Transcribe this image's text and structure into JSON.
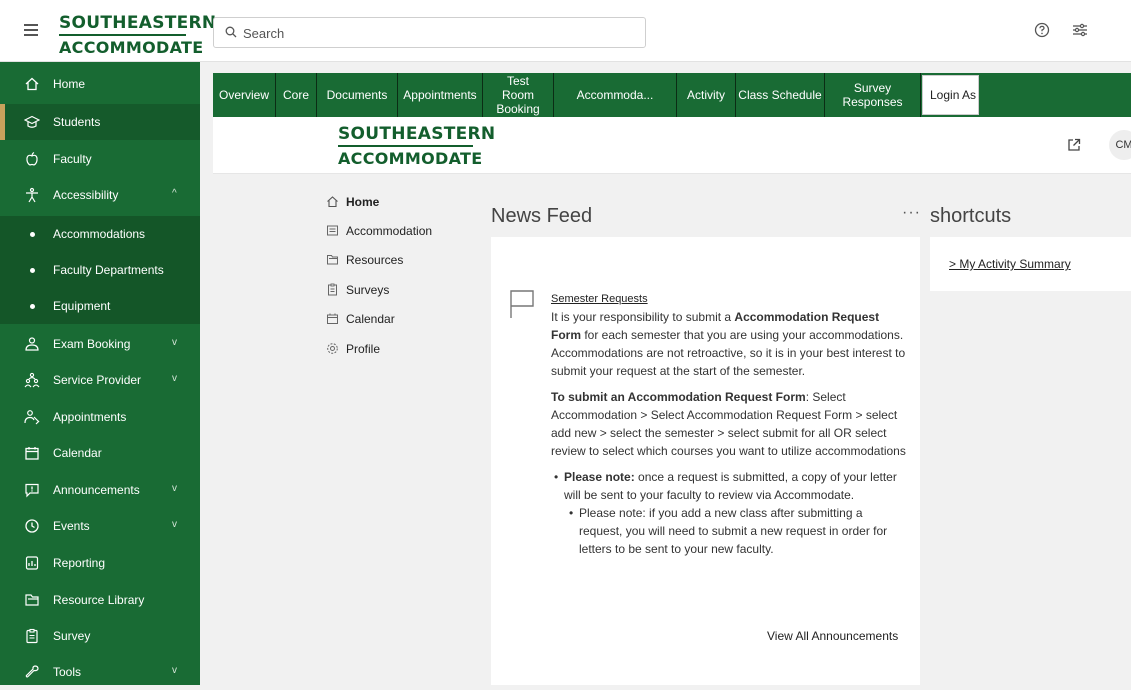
{
  "brand": {
    "line1": "SOUTHEASTERN",
    "line2": "ACCOMMODATE"
  },
  "search": {
    "placeholder": "Search"
  },
  "sidebar": {
    "items": [
      {
        "label": "Home",
        "icon": "home-icon"
      },
      {
        "label": "Students",
        "icon": "graduation-cap-icon",
        "active": true
      },
      {
        "label": "Faculty",
        "icon": "apple-icon"
      },
      {
        "label": "Accessibility",
        "icon": "accessibility-icon",
        "expanded": true
      },
      {
        "label": "Accommodations",
        "sub": true
      },
      {
        "label": "Faculty Departments",
        "sub": true
      },
      {
        "label": "Equipment",
        "sub": true
      },
      {
        "label": "Exam Booking",
        "icon": "exam-user-icon"
      },
      {
        "label": "Service Provider",
        "icon": "people-group-icon"
      },
      {
        "label": "Appointments",
        "icon": "handshake-icon"
      },
      {
        "label": "Calendar",
        "icon": "calendar-icon"
      },
      {
        "label": "Announcements",
        "icon": "announcement-icon"
      },
      {
        "label": "Events",
        "icon": "clock-icon"
      },
      {
        "label": "Reporting",
        "icon": "report-icon"
      },
      {
        "label": "Resource Library",
        "icon": "folder-icon"
      },
      {
        "label": "Survey",
        "icon": "clipboard-icon"
      },
      {
        "label": "Tools",
        "icon": "wrench-icon"
      }
    ]
  },
  "tabs": [
    "Overview",
    "Core",
    "Documents",
    "Appointments",
    "Test Room Booking",
    "Accommoda...",
    "Activity",
    "Class Schedule",
    "Survey Responses",
    "Login As"
  ],
  "header": {
    "avatar": "CM"
  },
  "left_nav": [
    "Home",
    "Accommodation",
    "Resources",
    "Surveys",
    "Calendar",
    "Profile"
  ],
  "news_feed": {
    "title": "News Feed",
    "more": "···",
    "announcement": {
      "title": "Semester Requests",
      "p1_a": "It is your responsibility to submit a ",
      "p1_b": "Accommodation Request Form",
      "p1_c": " for each semester that you are using your accommodations. Accommodations are not retroactive, so it is in your best interest to submit your request at the start of the semester.",
      "p2_a": "To submit an Accommodation Request Form",
      "p2_b": ":  Select Accommodation > Select Accommodation Request Form > select add new > select the semester > select submit for all OR select review to select which courses you want to utilize accommodations",
      "b1_a": "Please note:",
      "b1_b": " once a request is submitted, a copy of your letter will be sent to your faculty to review via Accommodate.",
      "b2": "Please note: if you add a new class after submitting a request, you will need to submit a new request in order for letters to be sent to your new faculty."
    },
    "view_all": "View All Announcements"
  },
  "shortcuts": {
    "title": "shortcuts",
    "link": "> My Activity Summary"
  }
}
